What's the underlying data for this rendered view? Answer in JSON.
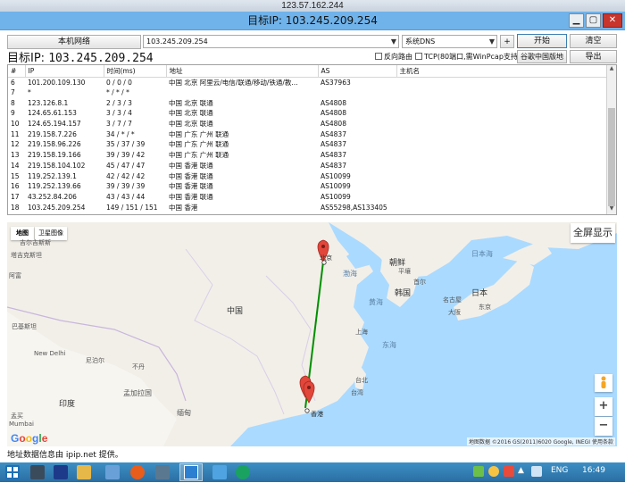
{
  "rdp": {
    "title": "123.57.162.244"
  },
  "window": {
    "title": "目标IP: 103.245.209.254"
  },
  "toolbar": {
    "local_network_label": "本机网络",
    "target_value": "103.245.209.254",
    "dns_value": "系统DNS",
    "plus_label": "+",
    "start_label": "开始",
    "clear_label": "清空",
    "google_map_label": "谷歌中国版地图",
    "export_label": "导出"
  },
  "target": {
    "label": "目标IP:",
    "ip": "103.245.209.254"
  },
  "options": {
    "reverse_route_label": "反向路由",
    "tcp_label": "TCP(80端口,需WinPcap支持)"
  },
  "table": {
    "headers": [
      "#",
      "IP",
      "时间(ms)",
      "地址",
      "AS",
      "主机名"
    ],
    "rows": [
      [
        "6",
        "101.200.109.130",
        "0 / 0 / 0",
        "中国 北京 阿里云/电信/联通/移动/铁通/教...",
        "AS37963",
        ""
      ],
      [
        "7",
        "*",
        "* / * / *",
        "",
        "",
        ""
      ],
      [
        "8",
        "123.126.8.1",
        "2 / 3 / 3",
        "中国 北京 联通",
        "AS4808",
        ""
      ],
      [
        "9",
        "124.65.61.153",
        "3 / 3 / 4",
        "中国 北京 联通",
        "AS4808",
        ""
      ],
      [
        "10",
        "124.65.194.157",
        "3 / 7 / 7",
        "中国 北京 联通",
        "AS4808",
        ""
      ],
      [
        "11",
        "219.158.7.226",
        "34 / * / *",
        "中国 广东 广州 联通",
        "AS4837",
        ""
      ],
      [
        "12",
        "219.158.96.226",
        "35 / 37 / 39",
        "中国 广东 广州 联通",
        "AS4837",
        ""
      ],
      [
        "13",
        "219.158.19.166",
        "39 / 39 / 42",
        "中国 广东 广州 联通",
        "AS4837",
        ""
      ],
      [
        "14",
        "219.158.104.102",
        "45 / 47 / 47",
        "中国 香港 联通",
        "AS4837",
        ""
      ],
      [
        "15",
        "119.252.139.1",
        "42 / 42 / 42",
        "中国 香港 联通",
        "AS10099",
        ""
      ],
      [
        "16",
        "119.252.139.66",
        "39 / 39 / 39",
        "中国 香港 联通",
        "AS10099",
        ""
      ],
      [
        "17",
        "43.252.84.206",
        "43 / 43 / 44",
        "中国 香港 联通",
        "AS10099",
        ""
      ],
      [
        "18",
        "103.245.209.254",
        "149 / 151 / 151",
        "中国 香港",
        "AS55298,AS133405",
        ""
      ]
    ]
  },
  "map": {
    "map_tab": "地图",
    "satellite_tab": "卫星图像",
    "fullscreen_label": "全屏显示",
    "zoom_in": "+",
    "zoom_out": "−",
    "google_logo": "Google",
    "attribution": "地图数据 ©2016 GS(2011)6020 Google, INEGI   使用条款",
    "labels": {
      "beijing": "北京",
      "china": "中国",
      "hongkong": "香港",
      "korea_n": "朝鲜",
      "korea_s": "韩国",
      "japan": "日本",
      "seoul": "首尔",
      "pyongyang": "平壤",
      "tokyo": "东京",
      "osaka": "大阪",
      "nagoya": "名古屋",
      "shanghai": "上海",
      "taipei": "台北",
      "taiwan": "台湾",
      "bohai": "渤海",
      "yellow_sea": "黄海",
      "east_sea": "东海",
      "sea_of_japan": "日本海",
      "india": "印度",
      "new_delhi": "New Delhi",
      "nepal": "尼泊尔",
      "bhutan": "不丹",
      "bangladesh": "孟加拉国",
      "myanmar": "缅甸",
      "tajikistan": "塔吉克斯坦",
      "tajikistan2": "吉尔吉斯斯",
      "pakistan": "巴基斯坦",
      "afghan": "阿富",
      "mumbai": "Mumbai",
      "mumbai_cn": "孟买"
    }
  },
  "status": {
    "text": "地址数据信息由 ipip.net 提供。"
  },
  "taskbar": {
    "lang": "ENG",
    "time": "16:49"
  }
}
